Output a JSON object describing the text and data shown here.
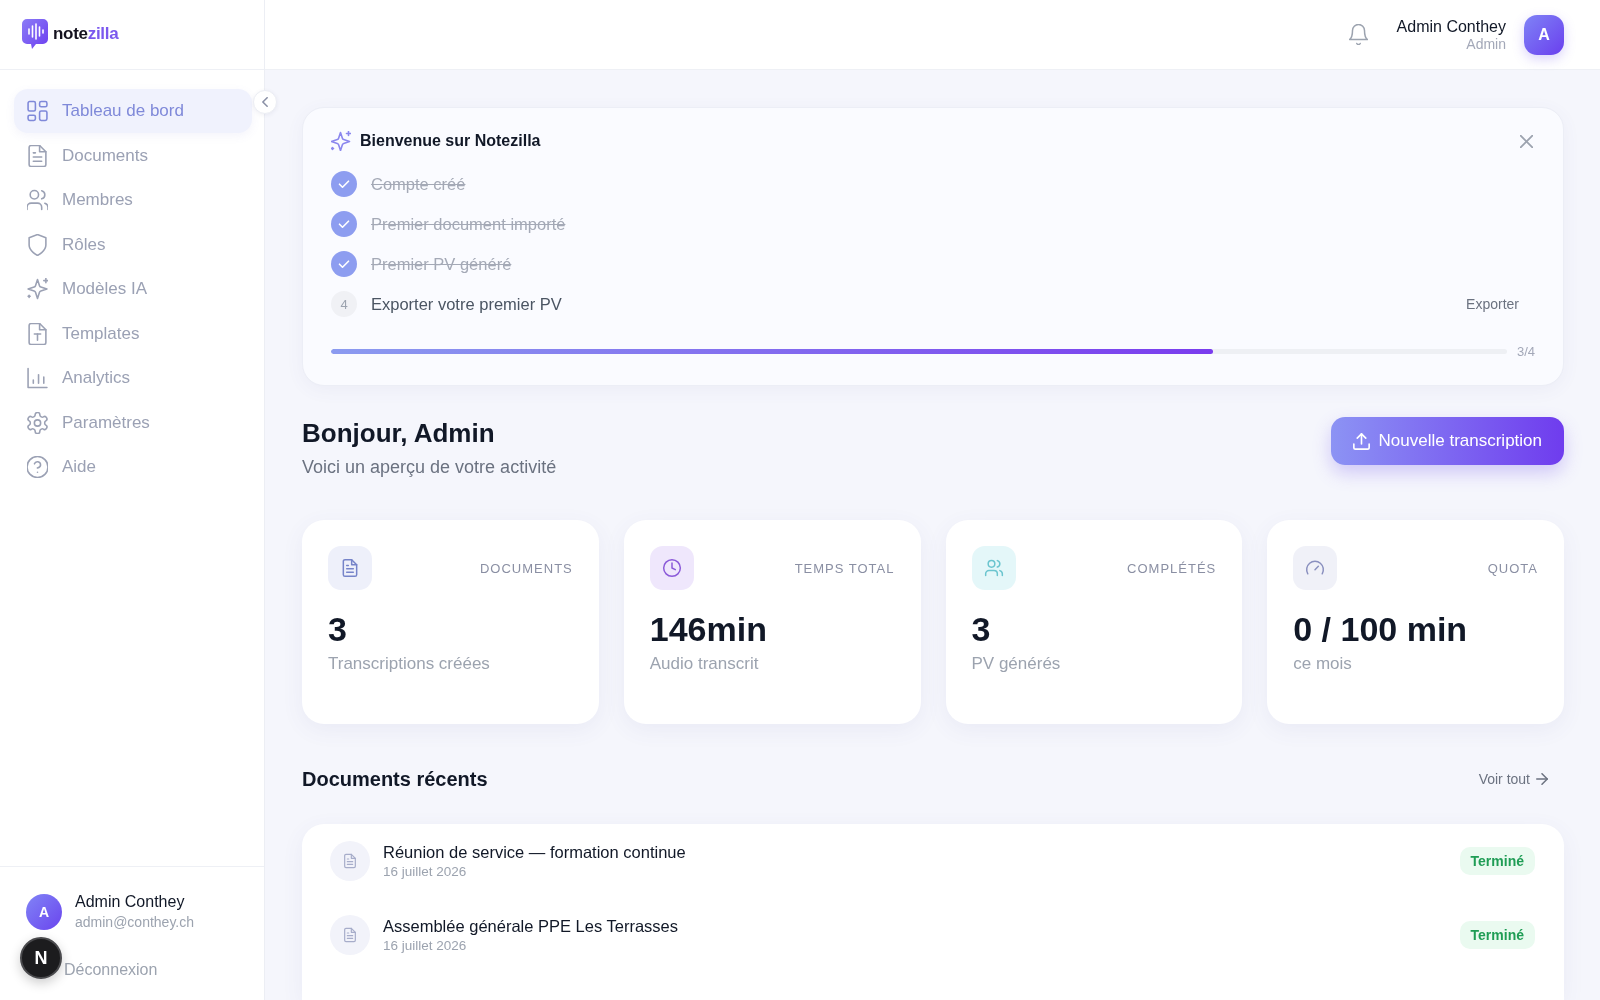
{
  "sidebar": {
    "logo": {
      "name": "note",
      "accent": "zilla"
    },
    "nav_items": [
      {
        "label": "Tableau de bord",
        "selected": true
      },
      {
        "label": "Documents",
        "selected": false
      },
      {
        "label": "Membres",
        "selected": false
      },
      {
        "label": "Rôles",
        "selected": false
      },
      {
        "label": "Modèles IA",
        "selected": false
      },
      {
        "label": "Templates",
        "selected": false
      },
      {
        "label": "Analytics",
        "selected": false
      },
      {
        "label": "Paramètres",
        "selected": false
      },
      {
        "label": "Aide",
        "selected": false
      }
    ],
    "user": {
      "avatar_initial": "A",
      "name": "Admin Conthey",
      "email": "admin@conthey.ch"
    },
    "logout": "Déconnexion"
  },
  "dev_tools_badge": {
    "label": "N"
  },
  "header": {
    "user_name": "Admin Conthey",
    "user_role": "Admin",
    "avatar_initial": "A"
  },
  "welcome": {
    "title": "Bienvenue sur Notezilla",
    "steps": [
      {
        "label": "Compte créé",
        "done": true
      },
      {
        "label": "Premier document importé",
        "done": true
      },
      {
        "label": "Premier PV généré",
        "done": true
      },
      {
        "label": "Exporter votre premier PV",
        "done": false,
        "number": "4",
        "action": "Exporter"
      }
    ],
    "progress": {
      "level": 0.75,
      "reading": "3/4"
    }
  },
  "greeting": {
    "title": "Bonjour, Admin",
    "subtitle": "Voici un aperçu de votre activité",
    "button": "Nouvelle transcription"
  },
  "stats": [
    {
      "label": "DOCUMENTS",
      "value": "3",
      "caption": "Transcriptions créées",
      "color": "#eef0fa"
    },
    {
      "label": "TEMPS TOTAL",
      "value": "146min",
      "caption": "Audio transcrit",
      "color": "#efe7fc"
    },
    {
      "label": "COMPLÉTÉS",
      "value": "3",
      "caption": "PV générés",
      "color": "#e4f7f9"
    },
    {
      "label": "QUOTA",
      "value": "0 / 100 min",
      "caption": "ce mois",
      "color": "#f0f1f8"
    }
  ],
  "recent": {
    "title": "Documents récents",
    "link": "Voir tout",
    "documents": [
      {
        "title": "Réunion de service — formation continue",
        "date": "16 juillet 2026",
        "status": "Terminé"
      },
      {
        "title": "Assemblée générale PPE Les Terrasses",
        "date": "16 juillet 2026",
        "status": "Terminé"
      }
    ]
  }
}
